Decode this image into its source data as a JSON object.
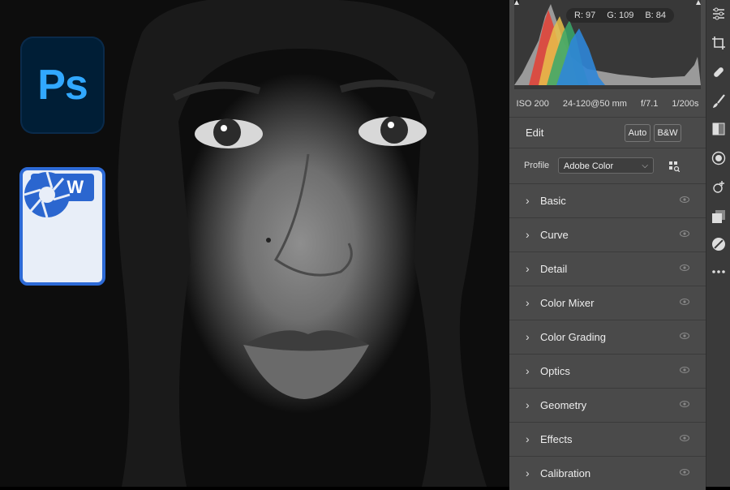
{
  "badges": {
    "ps_text": "Ps",
    "raw_text": "RAW"
  },
  "histogram": {
    "r": "R: 97",
    "g": "G: 109",
    "b": "B: 84"
  },
  "exif": {
    "iso": "ISO 200",
    "lens": "24-120@50 mm",
    "aperture": "f/7.1",
    "shutter": "1/200s"
  },
  "edit": {
    "title": "Edit",
    "auto": "Auto",
    "bw": "B&W"
  },
  "profile": {
    "label": "Profile",
    "value": "Adobe Color"
  },
  "sections": [
    "Basic",
    "Curve",
    "Detail",
    "Color Mixer",
    "Color Grading",
    "Optics",
    "Geometry",
    "Effects",
    "Calibration"
  ],
  "toolbar": [
    "edit-sliders-icon",
    "crop-icon",
    "healing-icon",
    "brush-icon",
    "linear-gradient-icon",
    "radial-gradient-icon",
    "red-eye-icon",
    "snapshots-icon",
    "presets-icon",
    "more-icon"
  ]
}
